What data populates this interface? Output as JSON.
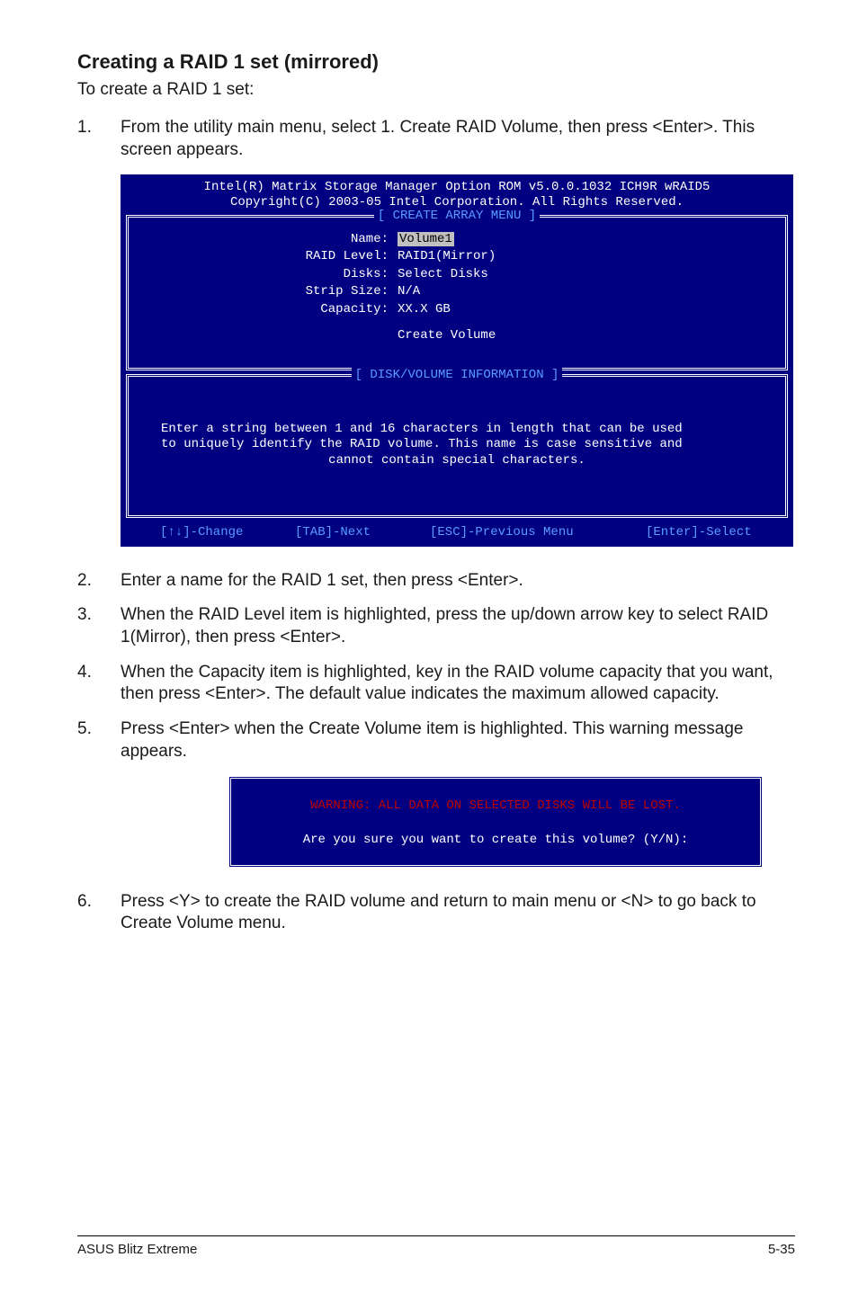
{
  "heading": "Creating a RAID 1 set (mirrored)",
  "intro": "To create a RAID 1 set:",
  "step1": {
    "num": "1.",
    "text": "From the utility main menu, select 1. Create RAID Volume, then press <Enter>. This screen appears."
  },
  "bios": {
    "title1": "Intel(R) Matrix Storage Manager Option ROM v5.0.0.1032 ICH9R wRAID5",
    "title2": "Copyright(C) 2003-05 Intel Corporation. All Rights Reserved.",
    "menu_label": "[ CREATE ARRAY MENU ]",
    "fields": {
      "name_k": "Name:",
      "name_v": "Volume1",
      "raid_k": "RAID Level:",
      "raid_v": "RAID1(Mirror)",
      "disks_k": "Disks:",
      "disks_v": "Select Disks",
      "strip_k": "Strip Size:",
      "strip_v": "N/A",
      "cap_k": "Capacity:",
      "cap_v": "XX.X  GB"
    },
    "create_volume": "Create Volume",
    "info_label": "[ DISK/VOLUME INFORMATION ]",
    "info_line1": "Enter a string between 1 and 16 characters in length that can be used",
    "info_line2": "to uniquely identify the RAID volume. This name is case sensitive and",
    "info_line3": "cannot contain special characters.",
    "bb_change": "[↑↓]-Change",
    "bb_next": "[TAB]-Next",
    "bb_prev": "[ESC]-Previous Menu",
    "bb_select": "[Enter]-Select"
  },
  "step2": {
    "num": "2.",
    "text": "Enter a name for the RAID 1 set, then press <Enter>."
  },
  "step3": {
    "num": "3.",
    "text": "When the RAID Level item is highlighted, press the up/down arrow key to select RAID 1(Mirror), then press <Enter>."
  },
  "step4": {
    "num": "4.",
    "text": "When the Capacity item is highlighted, key in the RAID volume capacity that you want, then press <Enter>. The default value indicates the maximum allowed capacity."
  },
  "step5": {
    "num": "5.",
    "text": "Press <Enter> when the Create Volume item is highlighted. This warning message appears."
  },
  "dialog": {
    "warn": "WARNING: ALL DATA ON SELECTED DISKS WILL BE LOST.",
    "prompt": "Are you sure you want to create this volume? (Y/N):"
  },
  "step6": {
    "num": "6.",
    "text": "Press <Y> to create the RAID volume and return to main menu or <N> to go back to Create Volume menu."
  },
  "footer": {
    "left": "ASUS Blitz Extreme",
    "right": "5-35"
  }
}
